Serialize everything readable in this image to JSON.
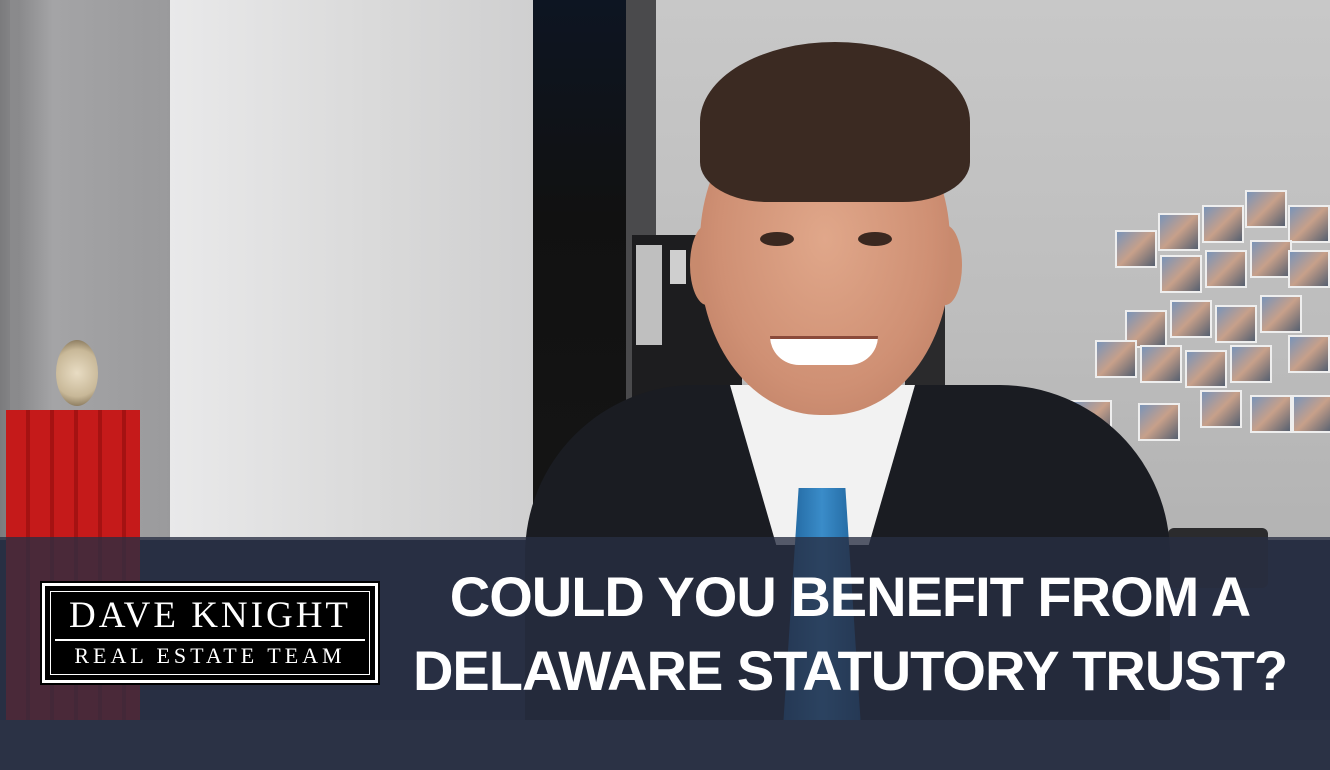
{
  "logo": {
    "line1": "DAVE KNIGHT",
    "line2": "REAL ESTATE TEAM"
  },
  "headline": {
    "line1": "COULD YOU BENEFIT FROM A",
    "line2": "DELAWARE STATUTORY TRUST?"
  },
  "colors": {
    "banner": "#2b3245",
    "text": "#ffffff",
    "tie": "#3a8cc9",
    "bags": "#c51a1a"
  }
}
